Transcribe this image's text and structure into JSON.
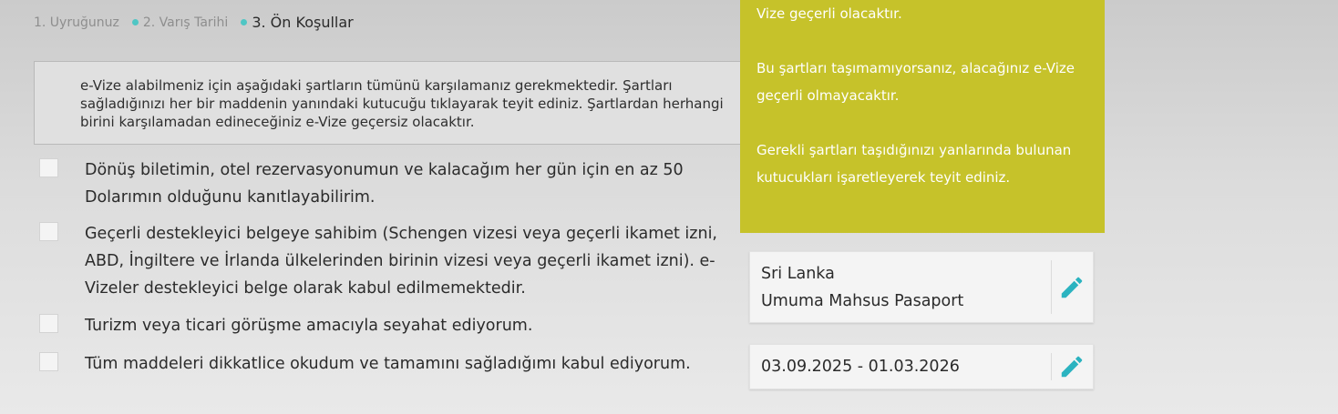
{
  "steps": [
    {
      "label": "1. Uyruğunuz"
    },
    {
      "label": "2. Varış Tarihi"
    },
    {
      "label": "3. Ön Koşullar"
    }
  ],
  "info_text": "e-Vize alabilmeniz için aşağıdaki şartların tümünü karşılamanız gerekmektedir. Şartları sağladığınızı her bir maddenin yanındaki kutucuğu tıklayarak teyit ediniz. Şartlardan herhangi birini karşılamadan edineceğiniz e-Vize geçersiz olacaktır.",
  "conditions": [
    {
      "text": "Dönüş biletimin, otel rezervasyonumun ve kalacağım her gün için en az 50 Dolarımın olduğunu kanıtlayabilirim.",
      "checked": false
    },
    {
      "text": "Geçerli destekleyici belgeye sahibim (Schengen vizesi veya geçerli ikamet izni, ABD, İngiltere ve İrlanda ülkelerinden birinin vizesi veya geçerli ikamet izni). e-Vizeler destekleyici belge olarak kabul edilmemektedir.",
      "checked": false
    },
    {
      "text": "Turizm veya ticari görüşme amacıyla seyahat ediyorum.",
      "checked": false
    },
    {
      "text": "Tüm maddeleri dikkatlice okudum ve tamamını sağladığımı kabul ediyorum.",
      "checked": false
    }
  ],
  "help_panel": {
    "line1": "Vize geçerli olacaktır.",
    "line2": "Bu şartları taşımamıyorsanız, alacağınız e-Vize geçerli olmayacaktır.",
    "line3": "Gerekli şartları taşıdığınızı yanlarında bulunan kutucukları işaretleyerek teyit ediniz."
  },
  "summary": {
    "country": "Sri Lanka",
    "passport_type": "Umuma Mahsus Pasaport",
    "date_range": "03.09.2025 - 01.03.2026"
  },
  "colors": {
    "accent_teal": "#4fc6c4",
    "help_panel_bg": "#c6c22a",
    "edit_icon": "#2bb3c0"
  },
  "icons": {
    "edit": "pencil-icon"
  }
}
